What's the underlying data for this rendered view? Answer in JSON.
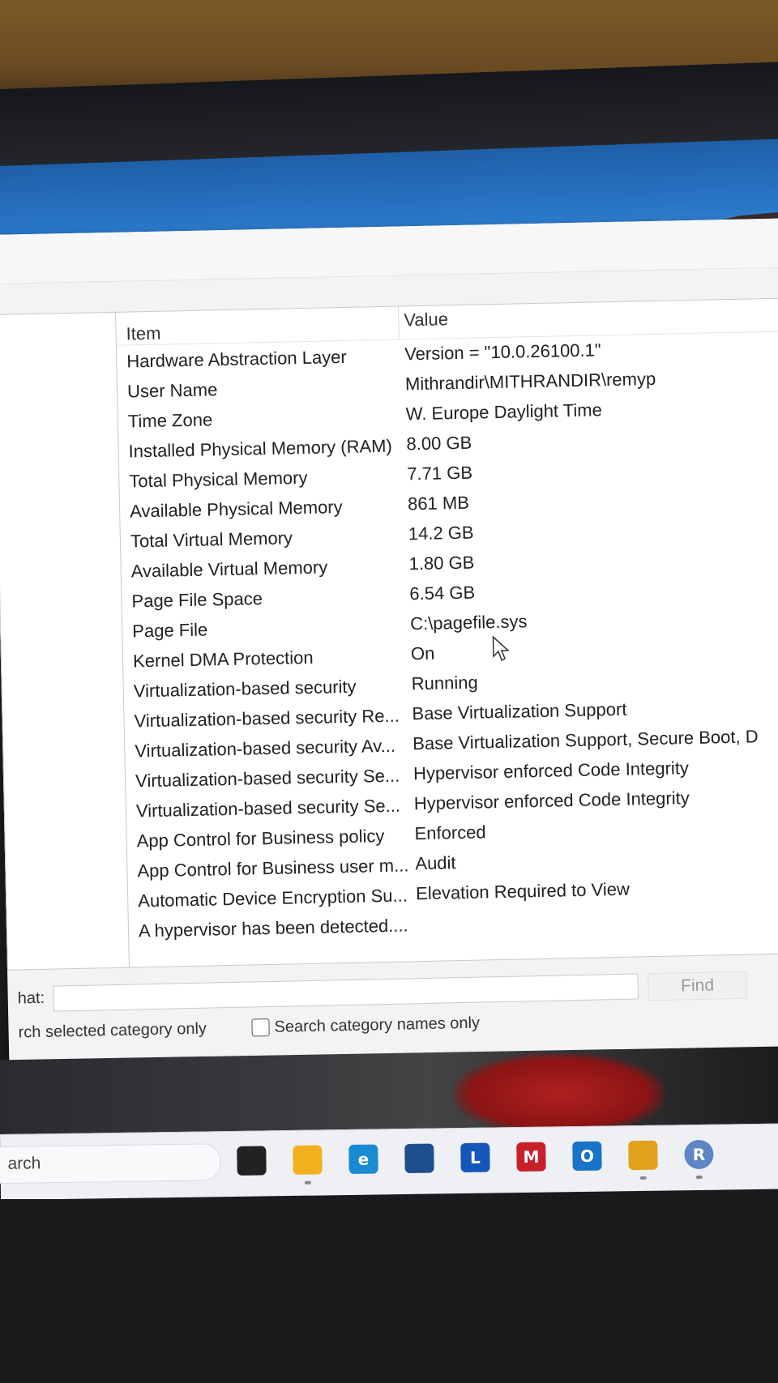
{
  "list": {
    "header": {
      "item": "Item",
      "value": "Value"
    },
    "rows": [
      {
        "item": "Hardware Abstraction Layer",
        "value": "Version = \"10.0.26100.1\""
      },
      {
        "item": "User Name",
        "value": "Mithrandir\\MITHRANDIR\\remyp"
      },
      {
        "item": "Time Zone",
        "value": "W. Europe Daylight Time"
      },
      {
        "item": "Installed Physical Memory (RAM)",
        "value": "8.00 GB"
      },
      {
        "item": "Total Physical Memory",
        "value": "7.71 GB"
      },
      {
        "item": "Available Physical Memory",
        "value": "861 MB"
      },
      {
        "item": "Total Virtual Memory",
        "value": "14.2 GB"
      },
      {
        "item": "Available Virtual Memory",
        "value": "1.80 GB"
      },
      {
        "item": "Page File Space",
        "value": "6.54 GB"
      },
      {
        "item": "Page File",
        "value": "C:\\pagefile.sys"
      },
      {
        "item": "Kernel DMA Protection",
        "value": "On"
      },
      {
        "item": "Virtualization-based security",
        "value": "Running"
      },
      {
        "item": "Virtualization-based security Re...",
        "value": "Base Virtualization Support"
      },
      {
        "item": "Virtualization-based security Av...",
        "value": "Base Virtualization Support, Secure Boot, D"
      },
      {
        "item": "Virtualization-based security Se...",
        "value": "Hypervisor enforced Code Integrity"
      },
      {
        "item": "Virtualization-based security Se...",
        "value": "Hypervisor enforced Code Integrity"
      },
      {
        "item": "App Control for Business policy",
        "value": "Enforced"
      },
      {
        "item": "App Control for Business user m...",
        "value": "Audit"
      },
      {
        "item": "Automatic Device Encryption Su...",
        "value": "Elevation Required to View"
      },
      {
        "item": "A hypervisor has been detected....",
        "value": ""
      }
    ]
  },
  "search": {
    "label": "hat:",
    "input_value": "",
    "find_button": "Find",
    "option_selected_category": "rch selected category only",
    "option_category_names": "Search category names only"
  },
  "taskbar": {
    "search_text": "arch",
    "icons": [
      {
        "name": "task-view-icon",
        "glyph": "",
        "color": "#222222"
      },
      {
        "name": "file-explorer-icon",
        "glyph": "",
        "color": "#f2b01e"
      },
      {
        "name": "edge-icon",
        "glyph": "e",
        "color": "#1a8ad4"
      },
      {
        "name": "store-icon",
        "glyph": "",
        "color": "#1f4e8c"
      },
      {
        "name": "l-app-icon",
        "glyph": "L",
        "color": "#1457b8"
      },
      {
        "name": "mcafee-icon",
        "glyph": "M",
        "color": "#c8202a"
      },
      {
        "name": "outlook-icon",
        "glyph": "O",
        "color": "#1a73c9"
      },
      {
        "name": "chrome-icon",
        "glyph": "",
        "color": "#e0a21a"
      },
      {
        "name": "profile-r-icon",
        "glyph": "R",
        "color": "#5f86c4"
      }
    ]
  }
}
